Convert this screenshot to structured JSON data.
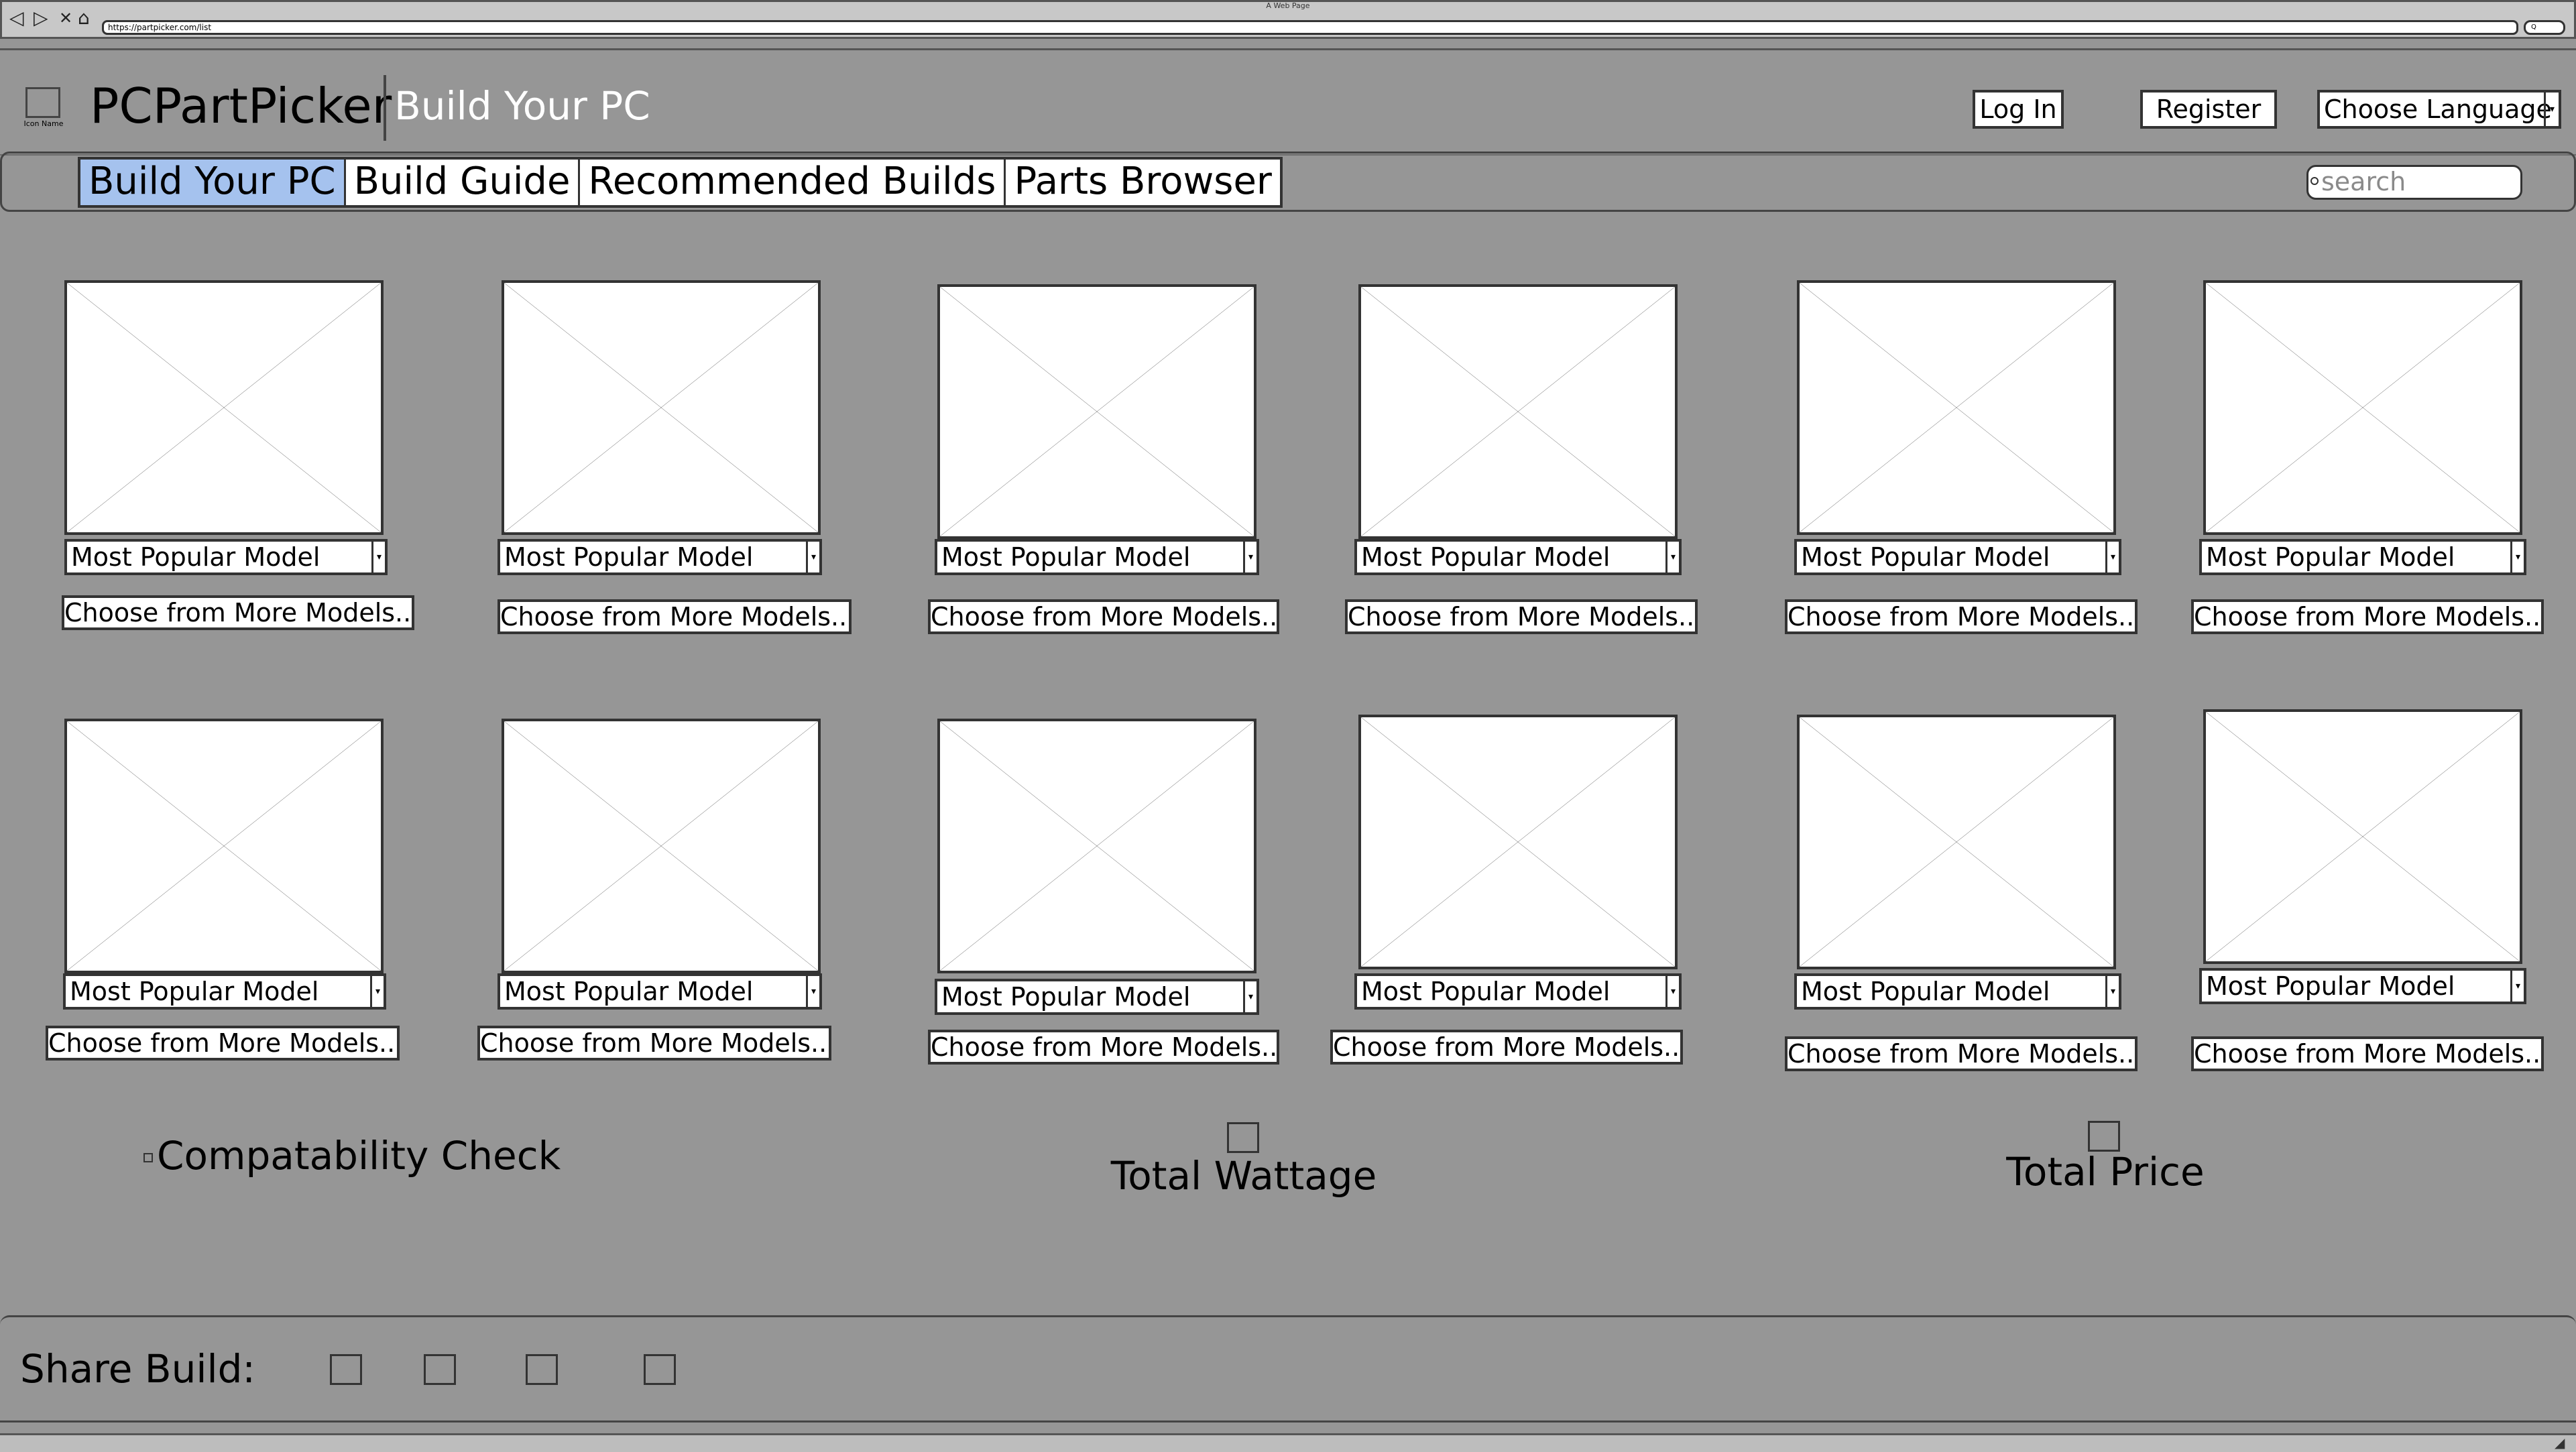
{
  "browser": {
    "title": "A Web Page",
    "url": "https://partpicker.com/list",
    "nav_glyphs": {
      "back": "◁",
      "forward": "▷",
      "close": "✕",
      "home": "⌂"
    },
    "search_glyph": "Q"
  },
  "header": {
    "icon_caption": "Icon Name",
    "site_name": "PCPartPicker",
    "subtitle": "Build Your PC",
    "login_label": "Log In",
    "register_label": "Register",
    "language_label": "Choose Language"
  },
  "nav": {
    "tabs": [
      {
        "label": "Build Your PC",
        "active": true
      },
      {
        "label": "Build Guide",
        "active": false
      },
      {
        "label": "Recommended Builds",
        "active": false
      },
      {
        "label": "Parts Browser",
        "active": false
      }
    ],
    "search_placeholder": "search"
  },
  "parts": {
    "select_label": "Most Popular Model",
    "more_label": "Choose from More Models...",
    "count": 12
  },
  "summary": {
    "compatibility_label": "Compatability Check",
    "wattage_label": "Total Wattage",
    "price_label": "Total Price"
  },
  "share": {
    "label": "Share Build:",
    "slots": 4
  },
  "colors": {
    "background": "#969696",
    "active_tab": "#a5c2ee",
    "subtitle": "#ffffff"
  }
}
